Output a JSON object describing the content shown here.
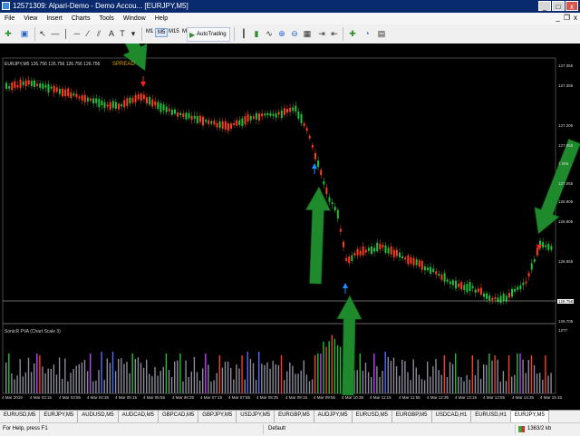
{
  "window": {
    "title": "12571309: Alpari-Demo - Demo Accou... [EURJPY,M5]",
    "minimize": "_",
    "maximize": "□",
    "close": "x"
  },
  "menu": {
    "items": [
      "File",
      "View",
      "Insert",
      "Charts",
      "Tools",
      "Window",
      "Help"
    ],
    "doc_min": "_",
    "doc_restore": "❐",
    "doc_close": "x"
  },
  "toolbar": {
    "autotrading_label": "AutoTrading",
    "timeframes": [
      "M1",
      "M5",
      "M15",
      "M30",
      "H1",
      "H4",
      "D1",
      "W1",
      "MN"
    ],
    "active_timeframe": "M5"
  },
  "chart": {
    "header": "EURJPY,M5  126.756 126.756 126.756 126.756",
    "spread": "SPREAD",
    "indicator_header": "SonicR PVA  (Chart Scale 3)",
    "price_labels": [
      "127.355",
      "127.355",
      "127.205",
      "127.055",
      "7.055",
      "127.055",
      "126.905",
      "126.905",
      "126.855",
      "126.756",
      "126.705",
      "1277"
    ],
    "current_price": "126.756",
    "time_labels": [
      "4 Mar 2019",
      "4 Mar 03:15",
      "4 Mar 03:55",
      "4 Mar 04:35",
      "4 Mar 05:15",
      "4 Mar 05:55",
      "4 Mar 06:35",
      "4 Mar 07:15",
      "4 Mar 07:55",
      "4 Mar 08:35",
      "4 Mar 09:15",
      "4 Mar 09:55",
      "4 Mar 10:35",
      "4 Mar 11:15",
      "4 Mar 11:55",
      "4 Mar 12:35",
      "4 Mar 13:15",
      "4 Mar 13:55",
      "4 Mar 14:35",
      "4 Mar 15:15"
    ],
    "colors": {
      "background": "#000000",
      "bull": "#22c03a",
      "bear": "#ff3b1a",
      "signal_up": "#1e90ff",
      "signal_down": "#ff2020",
      "overlay_arrow": "#1f8a2c",
      "volume_neutral": "#8a8a9a",
      "volume_blue": "#4d6bff",
      "volume_magenta": "#c040ff"
    }
  },
  "tabs": {
    "items": [
      "EURUSD,M5",
      "EURJPY,M5",
      "AUDUSD,M5",
      "AUDCAD,M5",
      "GBPCAD,M5",
      "GBPJPY,M5",
      "USDJPY,M5",
      "EURGBP,M5",
      "AUDJPY,M5",
      "EURUSD,M5",
      "EURGBP,M5",
      "USDCAD,H1",
      "EURUSD,H1",
      "EURJPY,M5"
    ],
    "active_index": 13
  },
  "status": {
    "help": "For Help, press F1",
    "profile": "Default",
    "traffic": "1363/2 kb"
  }
}
